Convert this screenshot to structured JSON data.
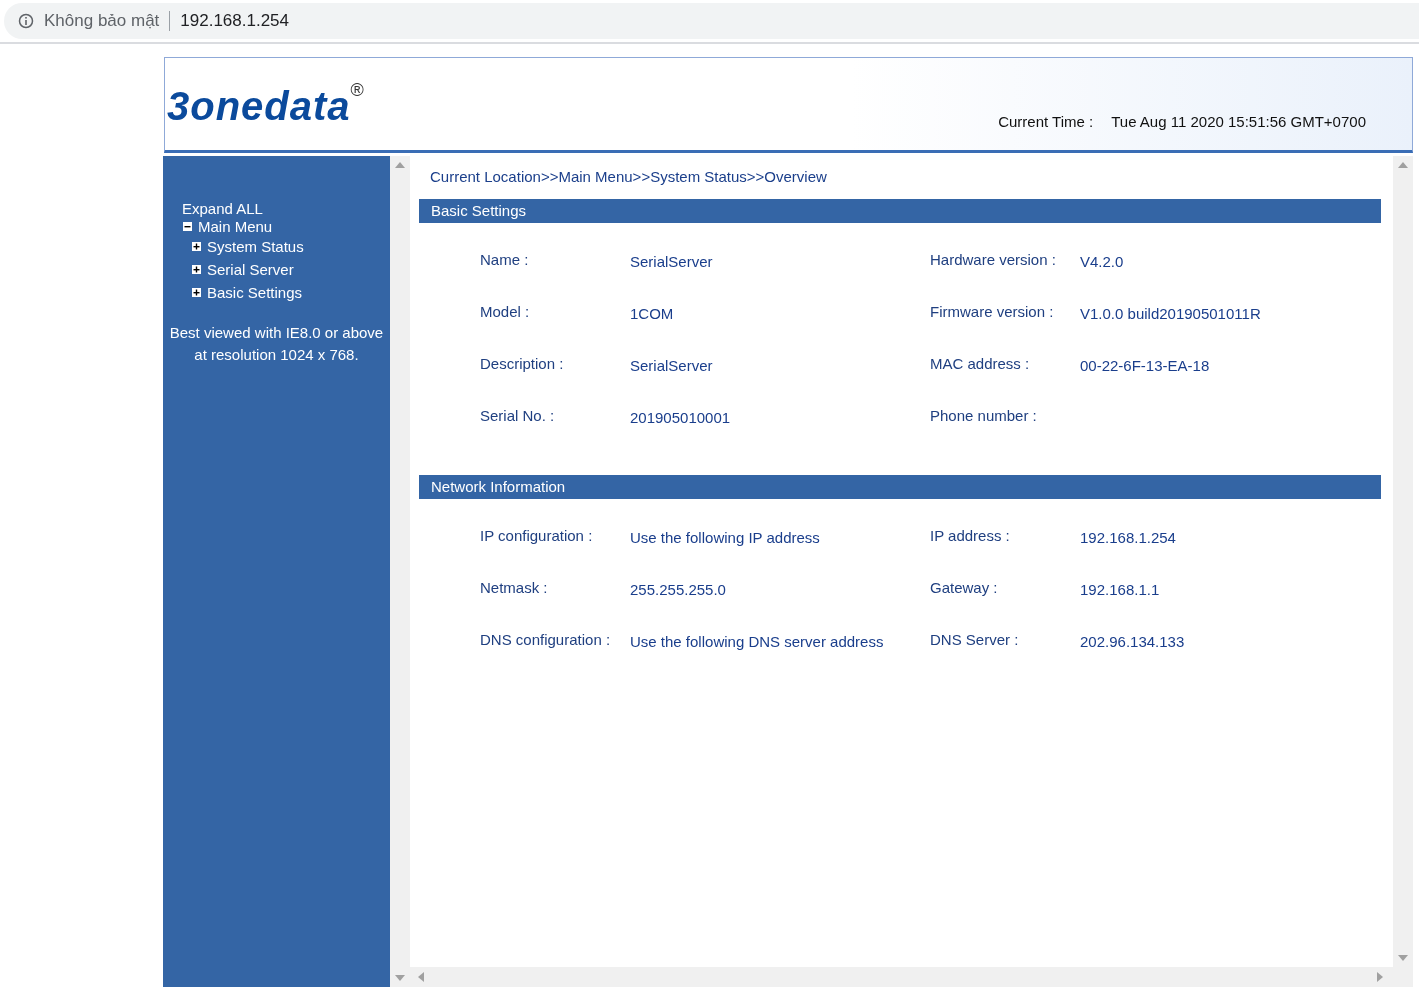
{
  "browser": {
    "security_label": "Không bảo mật",
    "address": "192.168.1.254"
  },
  "header": {
    "logo": "3onedata",
    "logo_mark": "®",
    "time_label": "Current Time :",
    "time_value": "Tue Aug 11 2020 15:51:56 GMT+0700"
  },
  "sidebar": {
    "expand_all": "Expand ALL",
    "tree": [
      {
        "label": "Main Menu",
        "expanded": true,
        "children": [
          {
            "label": "System Status",
            "expanded": false
          },
          {
            "label": "Serial Server",
            "expanded": false
          },
          {
            "label": "Basic Settings",
            "expanded": false
          }
        ]
      }
    ],
    "note": [
      "Best viewed with IE8.0 or above",
      "at resolution 1024 x 768."
    ]
  },
  "content": {
    "breadcrumb": "Current Location>>Main Menu>>System Status>>Overview",
    "sections": [
      {
        "title": "Basic Settings",
        "rows": [
          [
            {
              "label": "Name :",
              "value": "SerialServer"
            },
            {
              "label": "Hardware version :",
              "value": "V4.2.0"
            }
          ],
          [
            {
              "label": "Model :",
              "value": "1COM"
            },
            {
              "label": "Firmware version :",
              "value": "V1.0.0 build20190501011R"
            }
          ],
          [
            {
              "label": "Description :",
              "value": "SerialServer"
            },
            {
              "label": "MAC address :",
              "value": "00-22-6F-13-EA-18"
            }
          ],
          [
            {
              "label": "Serial No. :",
              "value": "201905010001"
            },
            {
              "label": "Phone number :"
            }
          ]
        ]
      },
      {
        "title": "Network Information",
        "rows": [
          [
            {
              "label": "IP configuration :",
              "value": "Use the following IP address"
            },
            {
              "label": "IP address :",
              "value": "192.168.1.254"
            }
          ],
          [
            {
              "label": "Netmask :",
              "value": "255.255.255.0"
            },
            {
              "label": "Gateway :",
              "value": "192.168.1.1"
            }
          ],
          [
            {
              "label": "DNS configuration :",
              "value": "Use the following DNS server address"
            },
            {
              "label": "DNS Server :",
              "value": "202.96.134.133"
            }
          ]
        ]
      }
    ]
  }
}
